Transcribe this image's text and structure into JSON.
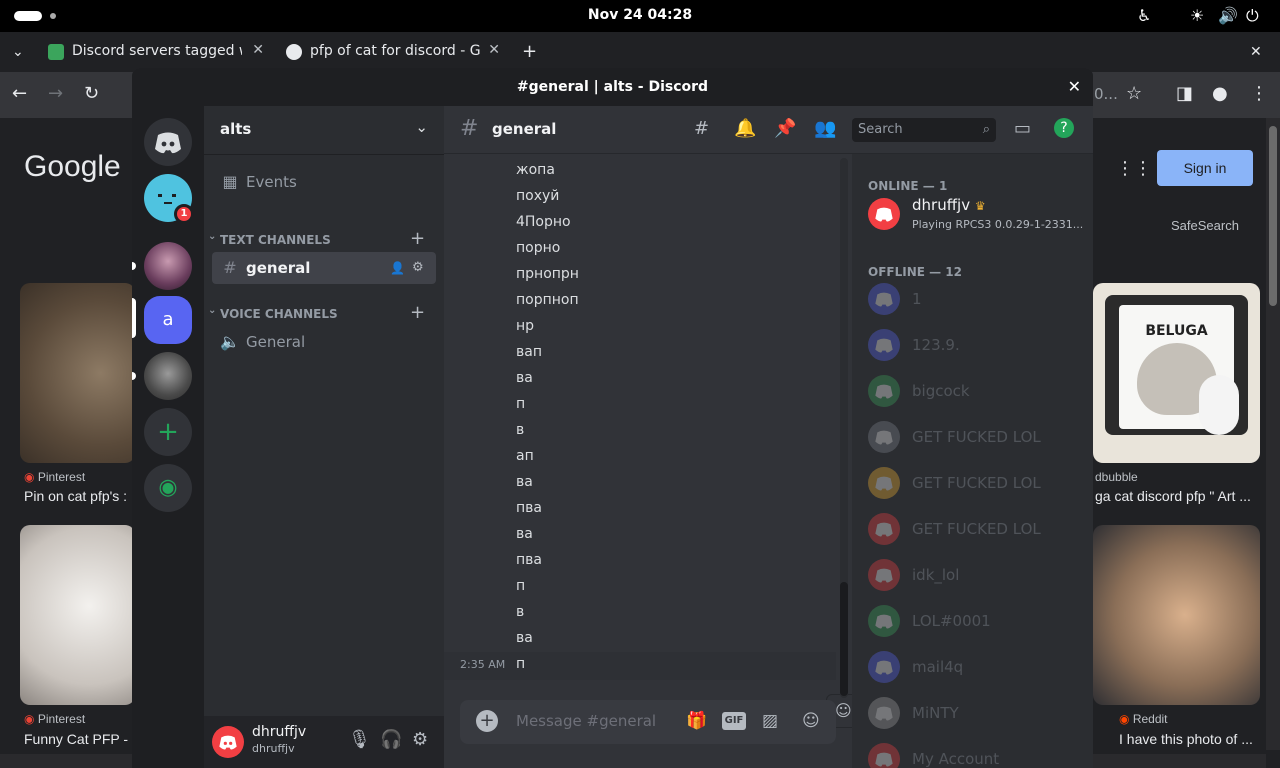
{
  "system": {
    "clock": "Nov 24  04:28",
    "icons": [
      "accessibility-icon",
      "brightness-icon",
      "volume-icon",
      "power-icon"
    ]
  },
  "browser": {
    "tabs": [
      {
        "title": "Discord servers tagged w",
        "favicon_color": "#3ba55c"
      },
      {
        "title": "pfp of cat for discord - G",
        "favicon_color": "#e8eaed"
      }
    ],
    "new_tab": "+",
    "close_window": "✕",
    "toolbar_icons": [
      "back-icon",
      "forward-icon",
      "reload-icon",
      "star-icon",
      "sidepanel-icon",
      "profile-icon",
      "menu-icon"
    ],
    "omnibox_fragment": "0..."
  },
  "google": {
    "logo": "Google",
    "signin": "Sign in",
    "safesearch": "SafeSearch",
    "results": [
      {
        "source": "Pinterest",
        "caption": "Pin on cat pfp's :"
      },
      {
        "source": "dbubble",
        "caption": "ga cat discord pfp \" Art ..."
      },
      {
        "source": "Pinterest",
        "caption": "Funny Cat PFP - I"
      },
      {
        "source": "Reddit",
        "caption": "I have this photo of ..."
      }
    ],
    "beluga_text": "BELUGA"
  },
  "discord": {
    "window_title": "#general | alts - Discord",
    "server_name": "alts",
    "guild_badge": "1",
    "guild_letter": "a",
    "events": "Events",
    "text_channels": "TEXT CHANNELS",
    "voice_channels": "VOICE CHANNELS",
    "channel_general": "general",
    "voice_general": "General",
    "user": {
      "name": "dhruffjv",
      "tag": "dhruffjv"
    },
    "header": {
      "channel": "general",
      "search_placeholder": "Search"
    },
    "messages": [
      "жопа",
      "похуй",
      "4Порно",
      "порно",
      "прнопрн",
      "порпноп",
      "нр",
      "вап",
      "ва",
      "п",
      "в",
      "ап",
      "ва",
      "пва",
      "ва",
      "пва",
      "п",
      "в",
      "ва",
      "п"
    ],
    "last_message_time": "2:35 AM",
    "composer_placeholder": "Message #general",
    "gif_label": "GIF",
    "online_header": "ONLINE — 1",
    "offline_header": "OFFLINE — 12",
    "online_members": [
      {
        "name": "dhruffjv",
        "activity": "Playing RPCS3 0.0.29-1-2331...",
        "color": "#f23f43"
      }
    ],
    "offline_members": [
      {
        "name": "1",
        "color": "#5865f2"
      },
      {
        "name": "123.9.",
        "color": "#5865f2"
      },
      {
        "name": "bigcock",
        "color": "#3ba55c"
      },
      {
        "name": "GET FUCKED LOL",
        "color": "#80848e"
      },
      {
        "name": "GET FUCKED LOL",
        "color": "#f0b232"
      },
      {
        "name": "GET FUCKED LOL",
        "color": "#f23f43"
      },
      {
        "name": "idk_lol",
        "color": "#f23f43"
      },
      {
        "name": "LOL#0001",
        "color": "#3ba55c"
      },
      {
        "name": "mail4q",
        "color": "#5865f2"
      },
      {
        "name": "MiNTY",
        "color": "#a0a0a0"
      },
      {
        "name": "My Account",
        "color": "#f23f43"
      }
    ]
  }
}
